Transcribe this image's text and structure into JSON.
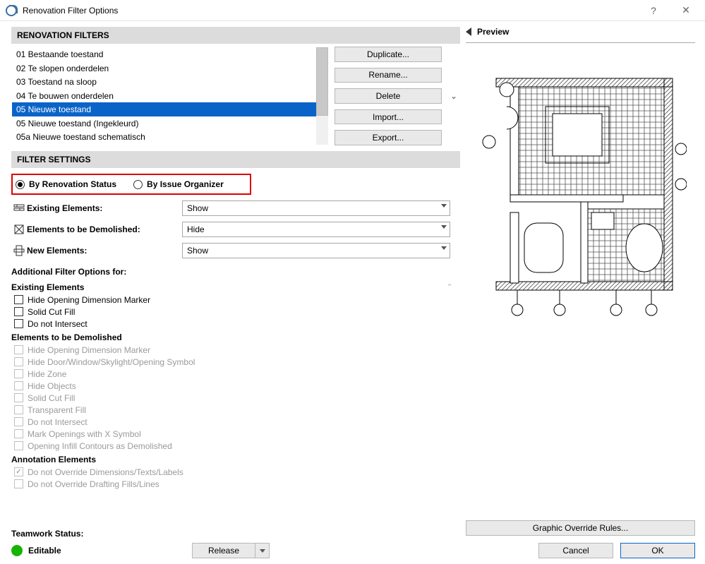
{
  "window": {
    "title": "Renovation Filter Options",
    "help": "?",
    "close": "✕"
  },
  "sections": {
    "filters_header": "RENOVATION FILTERS",
    "settings_header": "FILTER SETTINGS",
    "preview": "Preview"
  },
  "filters": [
    "01 Bestaande toestand",
    "02 Te slopen onderdelen",
    "03 Toestand na sloop",
    "04 Te bouwen onderdelen",
    "05 Nieuwe toestand",
    "05 Nieuwe toestand (Ingekleurd)",
    "05a Nieuwe toestand schematisch"
  ],
  "selected_filter_index": 4,
  "side_buttons": {
    "duplicate": "Duplicate...",
    "rename": "Rename...",
    "delete": "Delete",
    "import": "Import...",
    "export": "Export..."
  },
  "radio": {
    "by_status": "By Renovation Status",
    "by_issue": "By Issue Organizer",
    "selected": "by_status"
  },
  "rows": {
    "existing": {
      "label": "Existing Elements:",
      "value": "Show"
    },
    "demolish": {
      "label": "Elements to be Demolished:",
      "value": "Hide"
    },
    "new": {
      "label": "New Elements:",
      "value": "Show"
    }
  },
  "additional_header": "Additional Filter Options for:",
  "blocks": {
    "existing": {
      "title": "Existing Elements",
      "items": [
        {
          "label": "Hide Opening Dimension Marker",
          "enabled": true,
          "checked": false
        },
        {
          "label": "Solid Cut Fill",
          "enabled": true,
          "checked": false
        },
        {
          "label": "Do not Intersect",
          "enabled": true,
          "checked": false
        }
      ]
    },
    "demolished": {
      "title": "Elements to be Demolished",
      "items": [
        {
          "label": "Hide Opening Dimension Marker",
          "enabled": false,
          "checked": false
        },
        {
          "label": "Hide Door/Window/Skylight/Opening Symbol",
          "enabled": false,
          "checked": false
        },
        {
          "label": "Hide Zone",
          "enabled": false,
          "checked": false
        },
        {
          "label": "Hide Objects",
          "enabled": false,
          "checked": false
        },
        {
          "label": "Solid Cut Fill",
          "enabled": false,
          "checked": false
        },
        {
          "label": "Transparent Fill",
          "enabled": false,
          "checked": false
        },
        {
          "label": "Do not Intersect",
          "enabled": false,
          "checked": false
        },
        {
          "label": "Mark Openings with X Symbol",
          "enabled": false,
          "checked": false
        },
        {
          "label": "Opening Infill Contours as Demolished",
          "enabled": false,
          "checked": false
        }
      ]
    },
    "annotation": {
      "title": "Annotation Elements",
      "items": [
        {
          "label": "Do not Override Dimensions/Texts/Labels",
          "enabled": false,
          "checked": true
        },
        {
          "label": "Do not Override Drafting Fills/Lines",
          "enabled": false,
          "checked": false
        }
      ]
    }
  },
  "teamwork": {
    "label": "Teamwork Status:",
    "status": "Editable",
    "release": "Release"
  },
  "footer": {
    "rules": "Graphic Override Rules...",
    "cancel": "Cancel",
    "ok": "OK"
  }
}
